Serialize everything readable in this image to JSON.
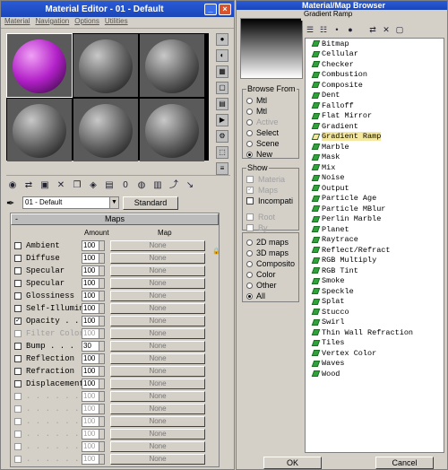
{
  "material_editor": {
    "title": "Material Editor - 01 - Default",
    "menu": [
      "Material",
      "Navigation",
      "Options",
      "Utilities"
    ],
    "material_name": "01 - Default",
    "material_type": "Standard",
    "maps_rollout": {
      "header": "Maps",
      "collapse_glyph": "-",
      "col_amount": "Amount",
      "col_map": "Map",
      "rows": [
        {
          "label": "Ambient",
          "checked": false,
          "amount": "100",
          "map": "None",
          "enabled": true
        },
        {
          "label": "Diffuse",
          "checked": false,
          "amount": "100",
          "map": "None",
          "enabled": true
        },
        {
          "label": "Specular",
          "checked": false,
          "amount": "100",
          "map": "None",
          "enabled": true
        },
        {
          "label": "Specular",
          "checked": false,
          "amount": "100",
          "map": "None",
          "enabled": true
        },
        {
          "label": "Glossiness",
          "checked": false,
          "amount": "100",
          "map": "None",
          "enabled": true
        },
        {
          "label": "Self-Illumin",
          "checked": false,
          "amount": "100",
          "map": "None",
          "enabled": true
        },
        {
          "label": "Opacity . .",
          "checked": true,
          "amount": "100",
          "map": "None",
          "enabled": true
        },
        {
          "label": "Filter Color",
          "checked": false,
          "amount": "100",
          "map": "None",
          "enabled": false
        },
        {
          "label": "Bump . . .",
          "checked": false,
          "amount": "30",
          "map": "None",
          "enabled": true
        },
        {
          "label": "Reflection",
          "checked": false,
          "amount": "100",
          "map": "None",
          "enabled": true
        },
        {
          "label": "Refraction",
          "checked": false,
          "amount": "100",
          "map": "None",
          "enabled": true
        },
        {
          "label": "Displacement",
          "checked": false,
          "amount": "100",
          "map": "None",
          "enabled": true
        },
        {
          "label": ". . . . . .",
          "checked": false,
          "amount": "100",
          "map": "None",
          "enabled": false
        },
        {
          "label": ". . . . . .",
          "checked": false,
          "amount": "100",
          "map": "None",
          "enabled": false
        },
        {
          "label": ". . . . . .",
          "checked": false,
          "amount": "100",
          "map": "None",
          "enabled": false
        },
        {
          "label": ". . . . . .",
          "checked": false,
          "amount": "100",
          "map": "None",
          "enabled": false
        },
        {
          "label": ". . . . . .",
          "checked": false,
          "amount": "100",
          "map": "None",
          "enabled": false
        },
        {
          "label": ". . . . . .",
          "checked": false,
          "amount": "100",
          "map": "None",
          "enabled": false
        }
      ]
    }
  },
  "map_browser": {
    "title": "Material/Map Browser",
    "current": "Gradient Ramp",
    "browse_from": {
      "label": "Browse From",
      "options": [
        {
          "label": "Mtl",
          "selected": false,
          "enabled": true
        },
        {
          "label": "Mtl",
          "selected": false,
          "enabled": true
        },
        {
          "label": "Active",
          "selected": false,
          "enabled": false
        },
        {
          "label": "Select",
          "selected": false,
          "enabled": true
        },
        {
          "label": "Scene",
          "selected": false,
          "enabled": true
        },
        {
          "label": "New",
          "selected": true,
          "enabled": true
        }
      ]
    },
    "show": {
      "label": "Show",
      "options": [
        {
          "label": "Materia",
          "checked": false,
          "enabled": false
        },
        {
          "label": "Maps",
          "checked": true,
          "enabled": false
        },
        {
          "label": "Incompati",
          "checked": false,
          "enabled": true
        },
        {
          "label": "Root",
          "checked": false,
          "enabled": false
        },
        {
          "label": "By",
          "checked": false,
          "enabled": false
        }
      ]
    },
    "map_type": {
      "options": [
        {
          "label": "2D maps",
          "selected": false
        },
        {
          "label": "3D maps",
          "selected": false
        },
        {
          "label": "Composito",
          "selected": false
        },
        {
          "label": "Color",
          "selected": false
        },
        {
          "label": "Other",
          "selected": false
        },
        {
          "label": "All",
          "selected": true
        }
      ]
    },
    "items": [
      "Bitmap",
      "Cellular",
      "Checker",
      "Combustion",
      "Composite",
      "Dent",
      "Falloff",
      "Flat Mirror",
      "Gradient",
      "Gradient Ramp",
      "Marble",
      "Mask",
      "Mix",
      "Noise",
      "Output",
      "Particle Age",
      "Particle MBlur",
      "Perlin Marble",
      "Planet",
      "Raytrace",
      "Reflect/Refract",
      "RGB Multiply",
      "RGB Tint",
      "Smoke",
      "Speckle",
      "Splat",
      "Stucco",
      "Swirl",
      "Thin Wall Refraction",
      "Tiles",
      "Vertex Color",
      "Waves",
      "Wood"
    ],
    "highlighted_index": 9,
    "ok_label": "OK",
    "cancel_label": "Cancel"
  }
}
